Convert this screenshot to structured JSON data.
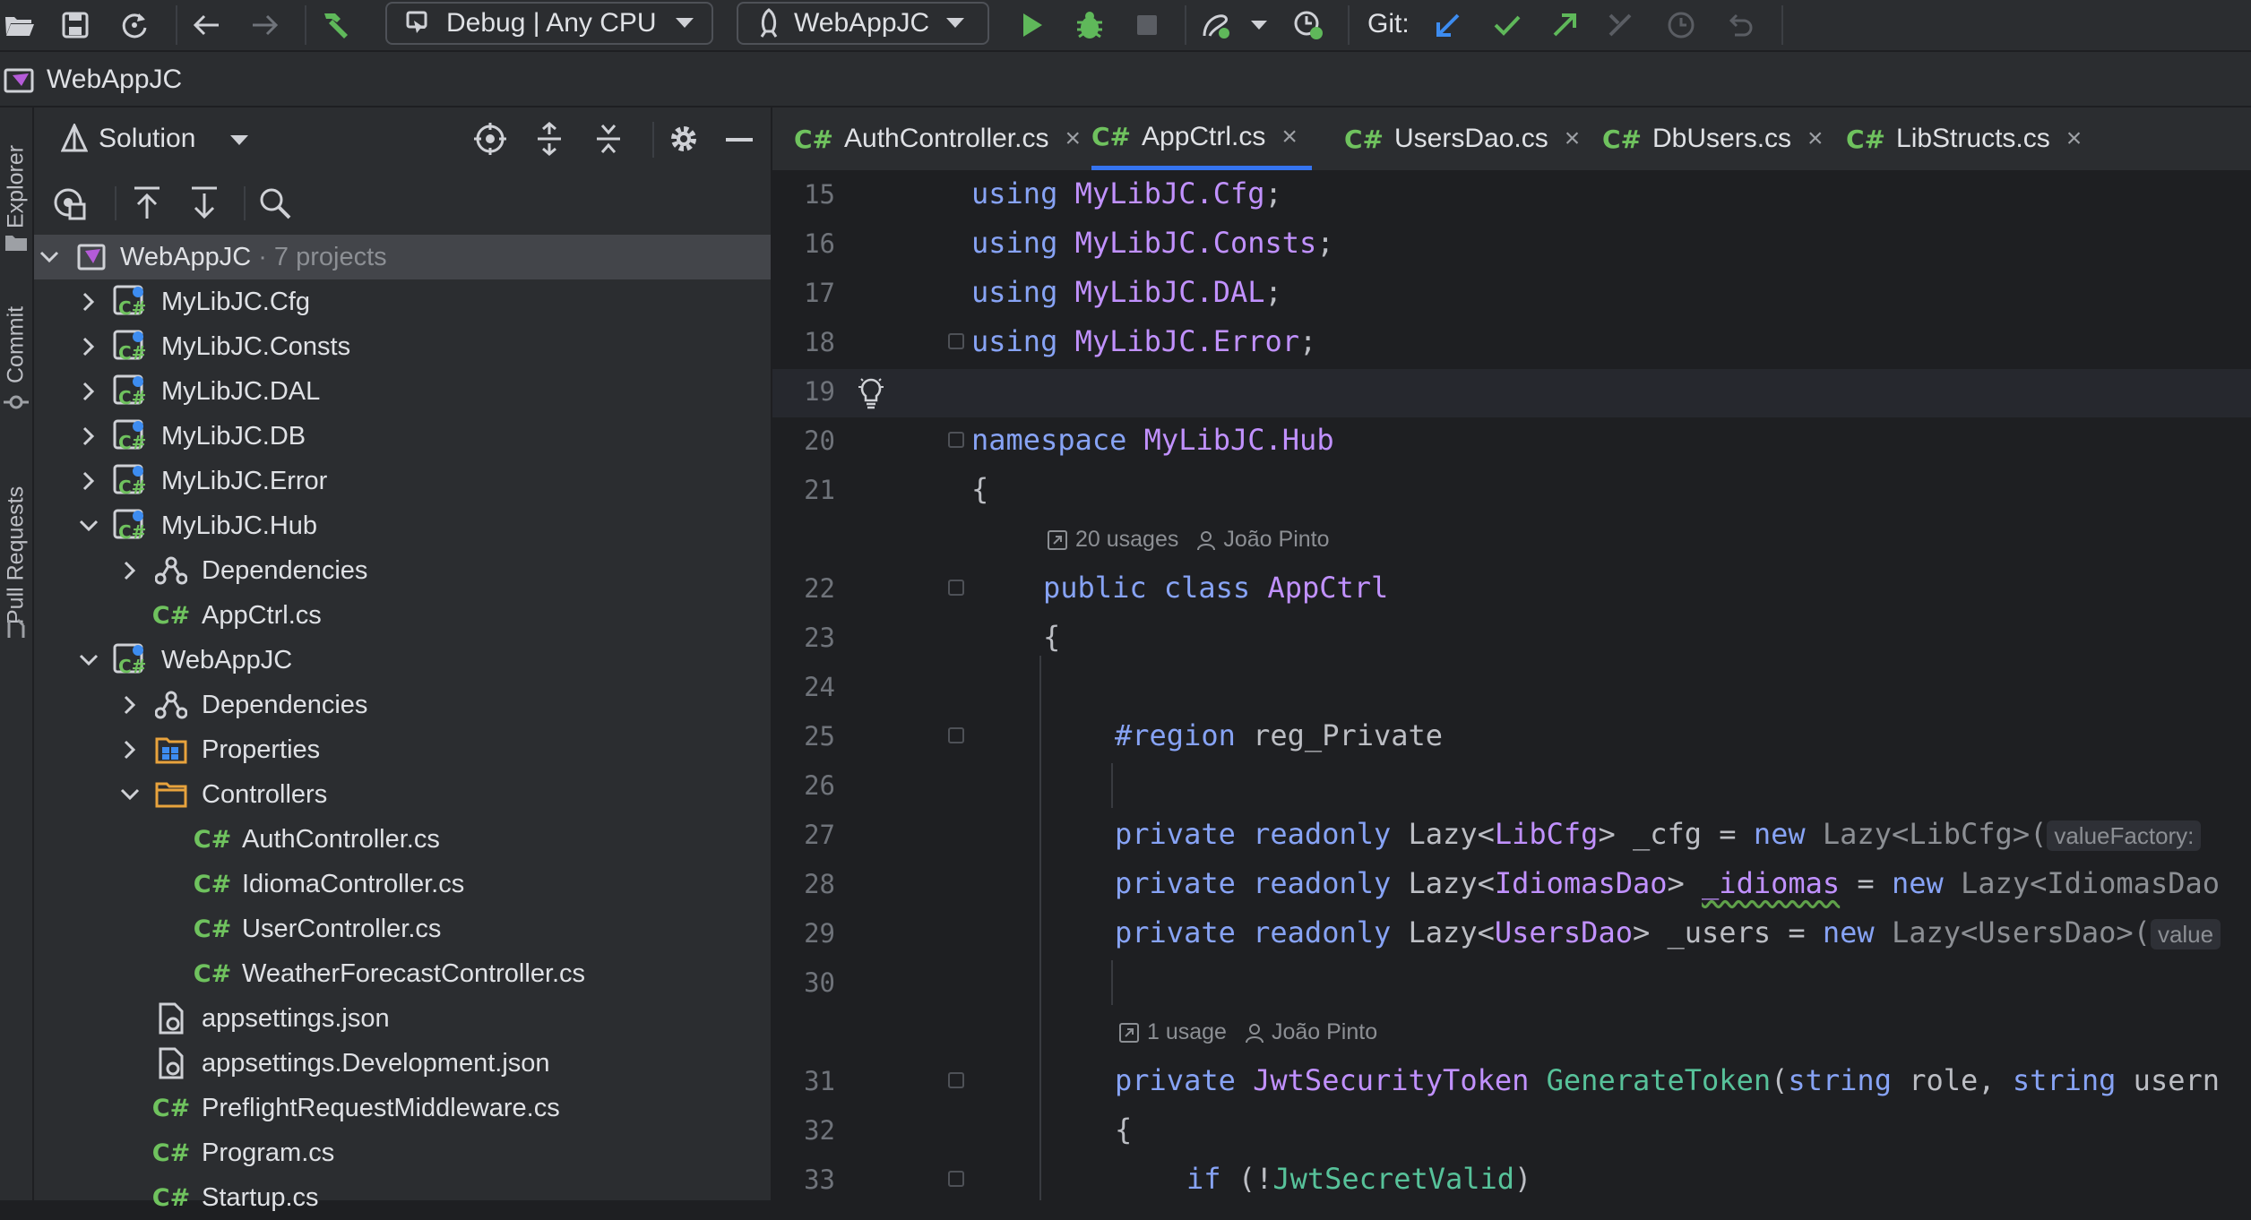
{
  "toolbar": {
    "config_label": "Debug | Any CPU",
    "run_target_label": "WebAppJC",
    "git_label": "Git:"
  },
  "navbar": {
    "breadcrumb": "WebAppJC"
  },
  "side_tabs": {
    "explorer": "Explorer",
    "commit": "Commit",
    "pull_requests": "Pull Requests"
  },
  "explorer": {
    "view_label": "Solution",
    "tree": [
      {
        "label": "WebAppJC",
        "suffix": "· 7 projects"
      },
      {
        "label": "MyLibJC.Cfg"
      },
      {
        "label": "MyLibJC.Consts"
      },
      {
        "label": "MyLibJC.DAL"
      },
      {
        "label": "MyLibJC.DB"
      },
      {
        "label": "MyLibJC.Error"
      },
      {
        "label": "MyLibJC.Hub"
      },
      {
        "label": "Dependencies"
      },
      {
        "label": "AppCtrl.cs"
      },
      {
        "label": "WebAppJC"
      },
      {
        "label": "Dependencies"
      },
      {
        "label": "Properties"
      },
      {
        "label": "Controllers"
      },
      {
        "label": "AuthController.cs"
      },
      {
        "label": "IdiomaController.cs"
      },
      {
        "label": "UserController.cs"
      },
      {
        "label": "WeatherForecastController.cs"
      },
      {
        "label": "appsettings.json"
      },
      {
        "label": "appsettings.Development.json"
      },
      {
        "label": "PreflightRequestMiddleware.cs"
      },
      {
        "label": "Program.cs"
      },
      {
        "label": "Startup.cs"
      }
    ]
  },
  "tabs": [
    {
      "label": "AuthController.cs"
    },
    {
      "label": "AppCtrl.cs"
    },
    {
      "label": "UsersDao.cs"
    },
    {
      "label": "DbUsers.cs"
    },
    {
      "label": "LibStructs.cs"
    }
  ],
  "cs_glyph": "C#",
  "close_glyph": "×",
  "editor": {
    "lines": [
      "15",
      "16",
      "17",
      "18",
      "19",
      "20",
      "21",
      "22",
      "23",
      "24",
      "25",
      "26",
      "27",
      "28",
      "29",
      "30",
      "31",
      "32",
      "33"
    ],
    "usages_1": "20 usages",
    "author_1": "João Pinto",
    "usages_2": "1 usage",
    "author_2": "João Pinto",
    "code": {
      "l15_kw": "using",
      "l15_ns": "MyLibJC.Cfg",
      "l15_end": ";",
      "l16_kw": "using",
      "l16_ns": "MyLibJC.Consts",
      "l16_end": ";",
      "l17_kw": "using",
      "l17_ns": "MyLibJC.DAL",
      "l17_end": ";",
      "l18_kw": "using",
      "l18_ns": "MyLibJC.Error",
      "l18_end": ";",
      "l20_kw": "namespace",
      "l20_ns": "MyLibJC.Hub",
      "l21": "{",
      "l22_kw": "public class",
      "l22_ty": "AppCtrl",
      "l23": "{",
      "l25_kw": "#region",
      "l25_name": "reg_Private",
      "l27_kw": "private readonly",
      "l27_a": "Lazy<",
      "l27_ty": "LibCfg",
      "l27_b": "> _cfg = ",
      "l27_new": "new",
      "l27_c": " Lazy<LibCfg>(",
      "l27_hint": "valueFactory:",
      "l28_kw": "private readonly",
      "l28_a": "Lazy<",
      "l28_ty": "IdiomasDao",
      "l28_b": "> ",
      "l28_fld": "_idiomas",
      "l28_c": " = ",
      "l28_new": "new",
      "l28_d": " Lazy<IdiomasDao",
      "l29_kw": "private readonly",
      "l29_a": "Lazy<",
      "l29_ty": "UsersDao",
      "l29_b": "> _users = ",
      "l29_new": "new",
      "l29_c": " Lazy<UsersDao>(",
      "l29_hint": "value",
      "l31_kw": "private",
      "l31_ty": "JwtSecurityToken",
      "l31_fn": "GenerateToken",
      "l31_a": "(",
      "l31_s1": "string",
      "l31_b": " role, ",
      "l31_s2": "string",
      "l31_c": " usern",
      "l32": "{",
      "l33_kw": "if",
      "l33_a": " (!",
      "l33_fld": "JwtSecretValid",
      "l33_b": ")"
    }
  }
}
